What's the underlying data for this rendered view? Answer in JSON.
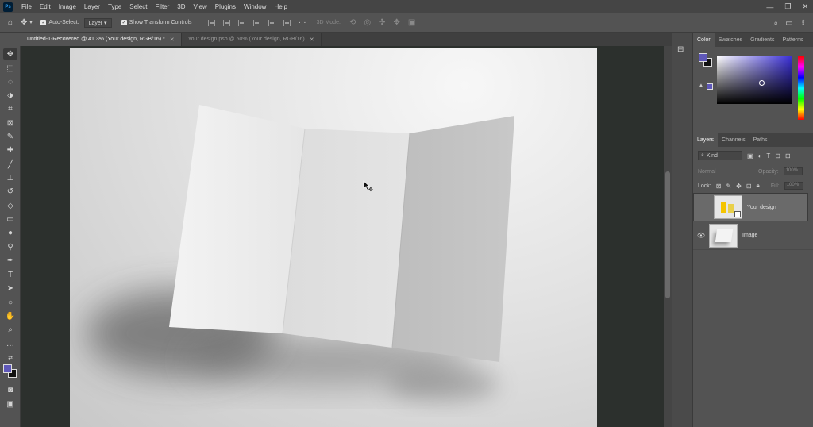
{
  "menu": [
    "File",
    "Edit",
    "Image",
    "Layer",
    "Type",
    "Select",
    "Filter",
    "3D",
    "View",
    "Plugins",
    "Window",
    "Help"
  ],
  "app_logo": "Ps",
  "options": {
    "auto_select_label": "Auto-Select:",
    "auto_select_target": "Layer",
    "show_transform_label": "Show Transform Controls",
    "mode_3d": "3D Mode:"
  },
  "tabs": [
    {
      "label": "Untitled-1-Recovered @ 41.3% (Your design, RGB/16) *",
      "active": true
    },
    {
      "label": "Your design.psb @ 50% (Your design, RGB/16)",
      "active": false
    }
  ],
  "color_panel": {
    "tabs": [
      "Color",
      "Swatches",
      "Gradients",
      "Patterns"
    ],
    "foreground": "#5f58b9",
    "background": "#111111"
  },
  "layers_panel": {
    "tabs": [
      "Layers",
      "Channels",
      "Paths"
    ],
    "kind_label": "Kind",
    "blend_mode": "Normal",
    "opacity_label": "Opacity:",
    "opacity_value": "100%",
    "lock_label": "Lock:",
    "fill_label": "Fill:",
    "fill_value": "100%",
    "layers": [
      {
        "name": "Your design",
        "selected": true,
        "visible": false
      },
      {
        "name": "Image",
        "selected": false,
        "visible": true
      }
    ]
  },
  "icons": {
    "home": "home-icon",
    "move": "move-icon",
    "search": "search-icon"
  }
}
